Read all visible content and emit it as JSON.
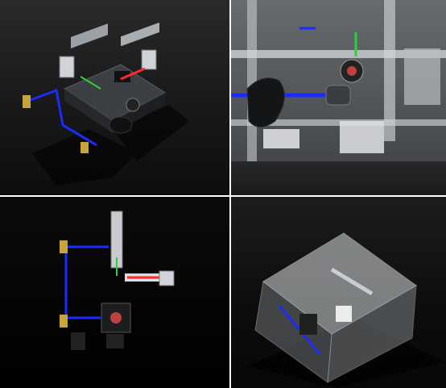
{
  "viewports": [
    {
      "id": "viewport-1",
      "view": "isometric",
      "background": "#1b1b1b"
    },
    {
      "id": "viewport-2",
      "view": "side-perspective",
      "background": "#3a3d40"
    },
    {
      "id": "viewport-3",
      "view": "top",
      "background": "#000000"
    },
    {
      "id": "viewport-4",
      "view": "enclosure-perspective",
      "background": "#0d0d0d"
    }
  ],
  "colors": {
    "fiber_blue": "#1b2cff",
    "laser_red": "#ff2a2a",
    "laser_green": "#2bd13a",
    "brass": "#c8a53a",
    "metal": "#bfc3c7",
    "acrylic": "#d9dde0"
  },
  "icons": [
    "gamepad-icon",
    "optical-table-icon"
  ]
}
